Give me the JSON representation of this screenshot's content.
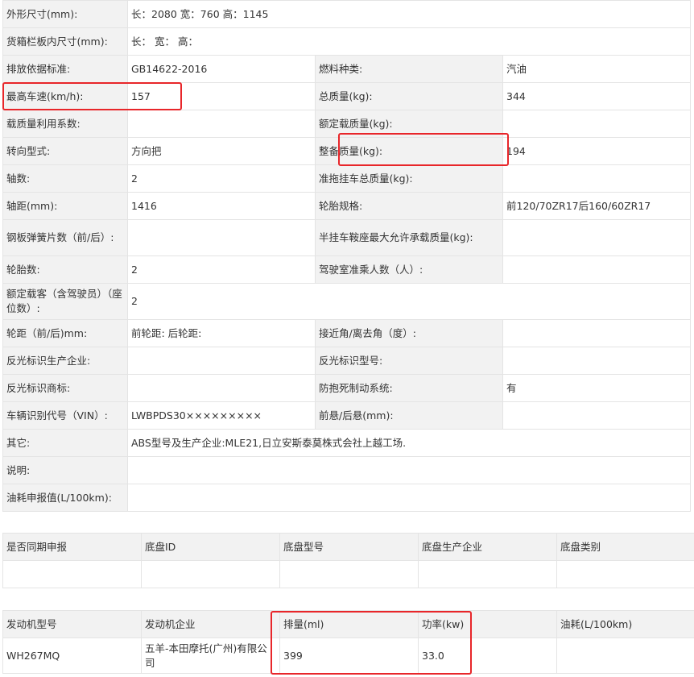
{
  "spec": {
    "dimensions": {
      "label": "外形尺寸(mm):",
      "value": "长：2080 宽：760 高：1145"
    },
    "cargo_box": {
      "label": "货箱栏板内尺寸(mm):",
      "value": "长： 宽： 高："
    },
    "emission": {
      "label": "排放依据标准:",
      "value": "GB14622-2016"
    },
    "fuel_type": {
      "label": "燃料种类:",
      "value": "汽油"
    },
    "max_speed": {
      "label": "最高车速(km/h):",
      "value": "157"
    },
    "total_mass": {
      "label": "总质量(kg):",
      "value": "344"
    },
    "load_util": {
      "label": "载质量利用系数:",
      "value": ""
    },
    "rated_load": {
      "label": "额定载质量(kg):",
      "value": ""
    },
    "steering": {
      "label": "转向型式:",
      "value": "方向把"
    },
    "curb_mass": {
      "label": "整备质量(kg):",
      "value": "194"
    },
    "axles": {
      "label": "轴数:",
      "value": "2"
    },
    "trailer_mass": {
      "label": "准拖挂车总质量(kg):",
      "value": ""
    },
    "wheelbase": {
      "label": "轴距(mm):",
      "value": "1416"
    },
    "tire_spec": {
      "label": "轮胎规格:",
      "value": "前120/70ZR17后160/60ZR17"
    },
    "leaf_springs": {
      "label": "钢板弹簧片数（前/后）:",
      "value": ""
    },
    "semi_trailer": {
      "label": "半挂车鞍座最大允许承载质量(kg):",
      "value": ""
    },
    "tires": {
      "label": "轮胎数:",
      "value": "2"
    },
    "cab_seats": {
      "label": "驾驶室准乘人数（人）:",
      "value": ""
    },
    "passengers": {
      "label": "额定载客（含驾驶员）（座位数）:",
      "value": "2"
    },
    "track": {
      "label": "轮距（前/后)mm:",
      "value": "前轮距: 后轮距:"
    },
    "approach": {
      "label": "接近角/离去角（度）:",
      "value": ""
    },
    "reflector_maker": {
      "label": "反光标识生产企业:",
      "value": ""
    },
    "reflector_model": {
      "label": "反光标识型号:",
      "value": ""
    },
    "reflector_brand": {
      "label": "反光标识商标:",
      "value": ""
    },
    "abs": {
      "label": "防抱死制动系统:",
      "value": "有"
    },
    "vin": {
      "label": "车辆识别代号（VIN）:",
      "value": "LWBPDS30×××××××××"
    },
    "overhang": {
      "label": "前悬/后悬(mm):",
      "value": ""
    },
    "other": {
      "label": "其它:",
      "value": "ABS型号及生产企业:MLE21,日立安斯泰莫株式会社上越工场."
    },
    "notes": {
      "label": "说明:",
      "value": ""
    },
    "fuel_reported": {
      "label": "油耗申报值(L/100km):",
      "value": ""
    }
  },
  "chassis": {
    "headers": [
      "是否同期申报",
      "底盘ID",
      "底盘型号",
      "底盘生产企业",
      "底盘类别"
    ],
    "row": [
      "",
      "",
      "",
      "",
      ""
    ]
  },
  "engine": {
    "headers": [
      "发动机型号",
      "发动机企业",
      "排量(ml)",
      "功率(kw)",
      "油耗(L/100km)"
    ],
    "row": [
      "WH267MQ",
      "五羊-本田摩托(广州)有限公司",
      "399",
      "33.0",
      ""
    ]
  },
  "colors": {
    "highlight": "#e8262a",
    "label_bg": "#f2f2f2",
    "border": "#e4e4e4"
  }
}
